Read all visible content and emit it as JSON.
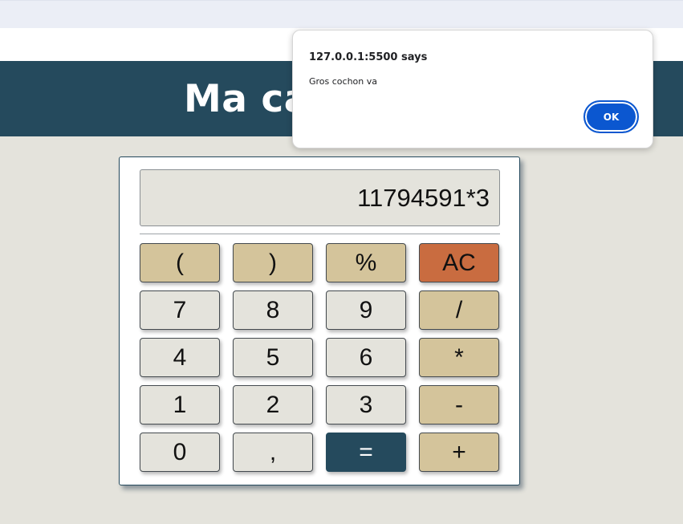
{
  "page": {
    "title": "Ma ca"
  },
  "display": {
    "expression": "11794591*3"
  },
  "keys": {
    "open_paren": "(",
    "close_paren": ")",
    "percent": "%",
    "clear": "AC",
    "seven": "7",
    "eight": "8",
    "nine": "9",
    "divide": "/",
    "four": "4",
    "five": "5",
    "six": "6",
    "multiply": "*",
    "one": "1",
    "two": "2",
    "three": "3",
    "minus": "-",
    "zero": "0",
    "comma": ",",
    "equals": "=",
    "plus": "+"
  },
  "alert": {
    "origin": "127.0.0.1:5500 says",
    "message": "Gros cochon va",
    "ok_label": "OK"
  },
  "colors": {
    "header": "#254a5d",
    "page_background": "#e4e3dc",
    "operator_key": "#d4c49b",
    "clear_key": "#c96c40",
    "equals_key": "#254a5d",
    "dialog_button": "#0b57d0"
  }
}
